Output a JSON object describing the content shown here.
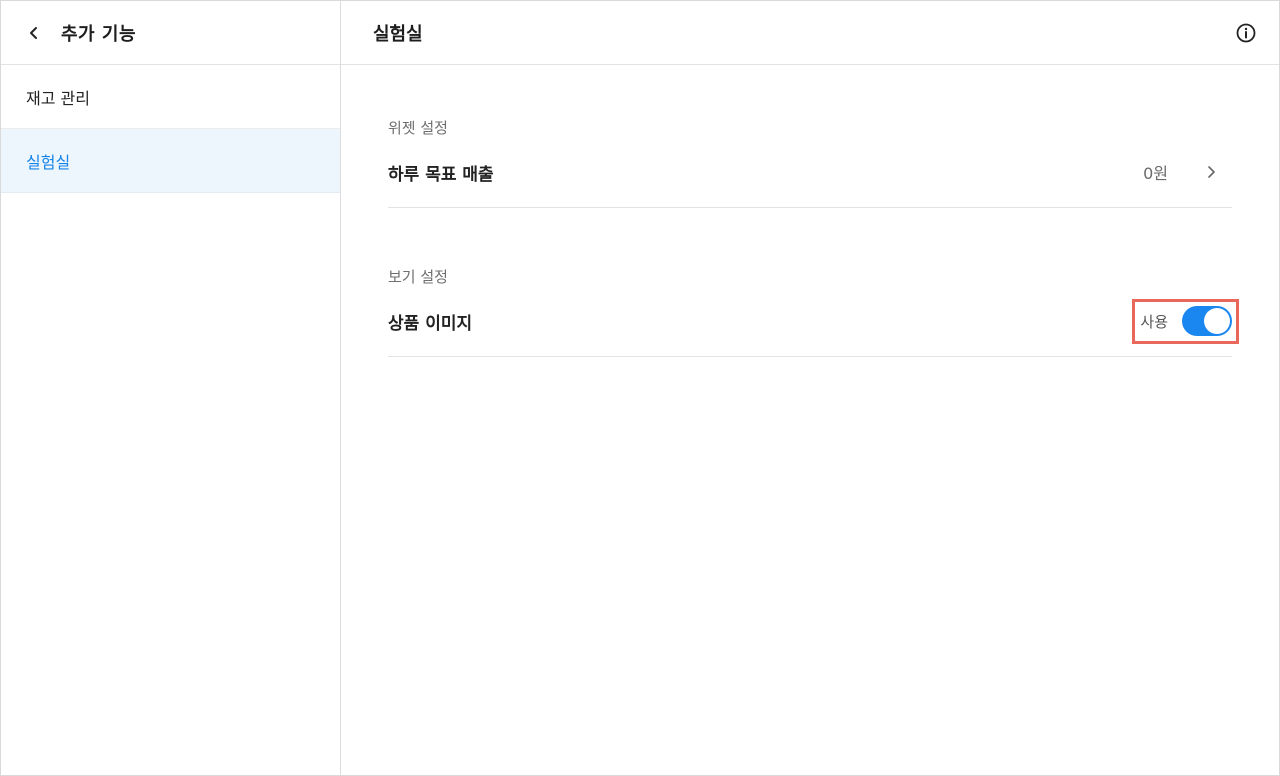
{
  "sidebar": {
    "title": "추가 기능",
    "items": [
      {
        "label": "재고 관리",
        "active": false
      },
      {
        "label": "실험실",
        "active": true
      }
    ]
  },
  "main": {
    "title": "실험실",
    "sections": [
      {
        "label": "위젯 설정",
        "row": {
          "label": "하루 목표 매출",
          "value": "0원"
        }
      },
      {
        "label": "보기 설정",
        "row": {
          "label": "상품 이미지",
          "toggle_label": "사용",
          "toggle_on": true
        }
      }
    ]
  },
  "colors": {
    "accent": "#1a86f0",
    "active_text": "#1583e6",
    "active_bg": "#eef6fd",
    "highlight_border": "#e8695b"
  },
  "icons": {
    "back": "chevron-left-icon",
    "info": "info-circle-icon",
    "row_arrow": "chevron-right-icon"
  }
}
